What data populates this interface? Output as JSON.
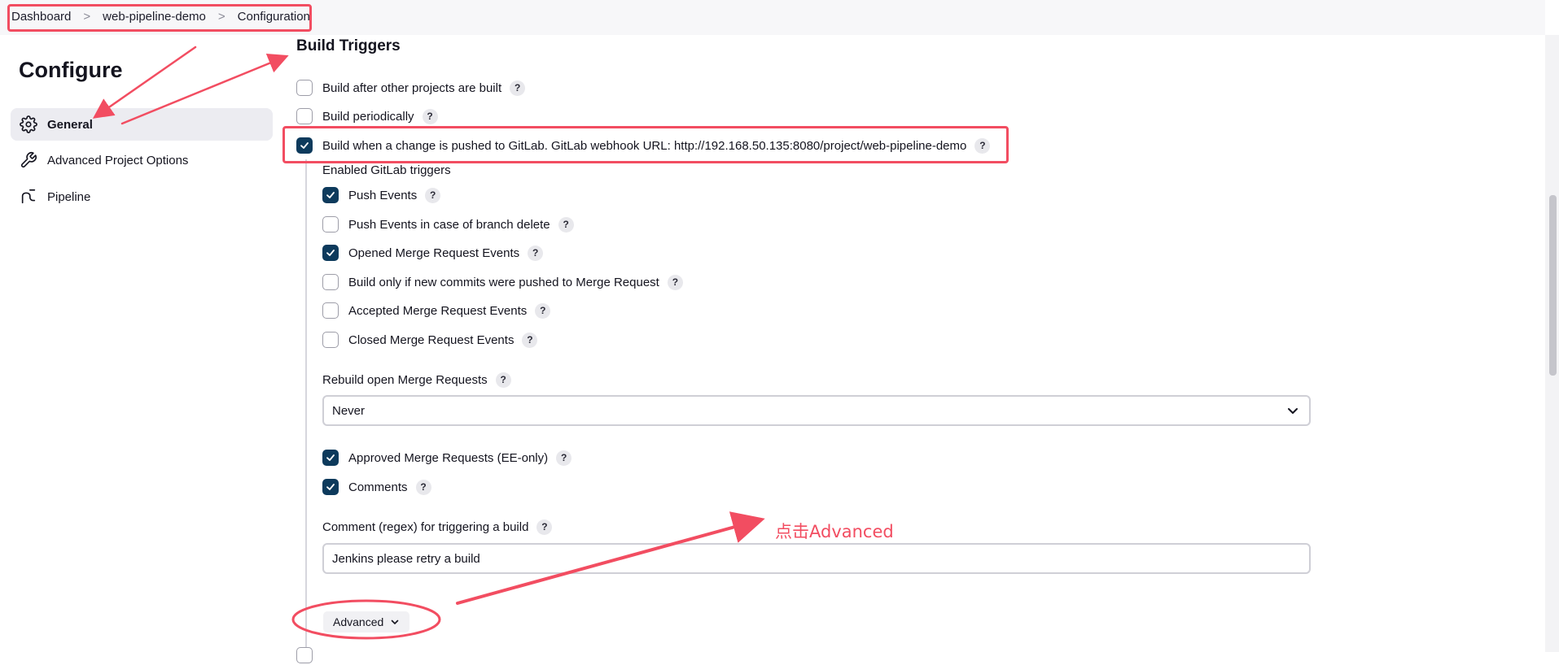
{
  "breadcrumb": {
    "items": [
      "Dashboard",
      "web-pipeline-demo",
      "Configuration"
    ],
    "separator": ">"
  },
  "sidebar": {
    "title": "Configure",
    "items": [
      {
        "label": "General",
        "icon": "gear-icon",
        "active": true
      },
      {
        "label": "Advanced Project Options",
        "icon": "wrench-icon",
        "active": false
      },
      {
        "label": "Pipeline",
        "icon": "pipeline-icon",
        "active": false
      }
    ]
  },
  "main": {
    "section_title": "Build Triggers",
    "triggers": [
      {
        "label": "Build after other projects are built",
        "checked": false
      },
      {
        "label": "Build periodically",
        "checked": false
      },
      {
        "label": "Build when a change is pushed to GitLab. GitLab webhook URL: http://192.168.50.135:8080/project/web-pipeline-demo",
        "checked": true
      }
    ],
    "gitlab_triggers_heading": "Enabled GitLab triggers",
    "gitlab_triggers": [
      {
        "label": "Push Events",
        "checked": true
      },
      {
        "label": "Push Events in case of branch delete",
        "checked": false
      },
      {
        "label": "Opened Merge Request Events",
        "checked": true
      },
      {
        "label": "Build only if new commits were pushed to Merge Request",
        "checked": false
      },
      {
        "label": "Accepted Merge Request Events",
        "checked": false
      },
      {
        "label": "Closed Merge Request Events",
        "checked": false
      }
    ],
    "rebuild": {
      "label": "Rebuild open Merge Requests",
      "selected": "Never"
    },
    "extra_triggers": [
      {
        "label": "Approved Merge Requests (EE-only)",
        "checked": true
      },
      {
        "label": "Comments",
        "checked": true
      }
    ],
    "comment_regex": {
      "label": "Comment (regex) for triggering a build",
      "value": "Jenkins please retry a build"
    },
    "advanced_button": "Advanced",
    "help_glyph": "?"
  },
  "annotation": {
    "text": "点击Advanced",
    "color": "#f24d61"
  },
  "colors": {
    "checkbox_checked": "#0d3a5c",
    "active_nav_bg": "#ececf1",
    "annotation_red": "#f24d61"
  }
}
